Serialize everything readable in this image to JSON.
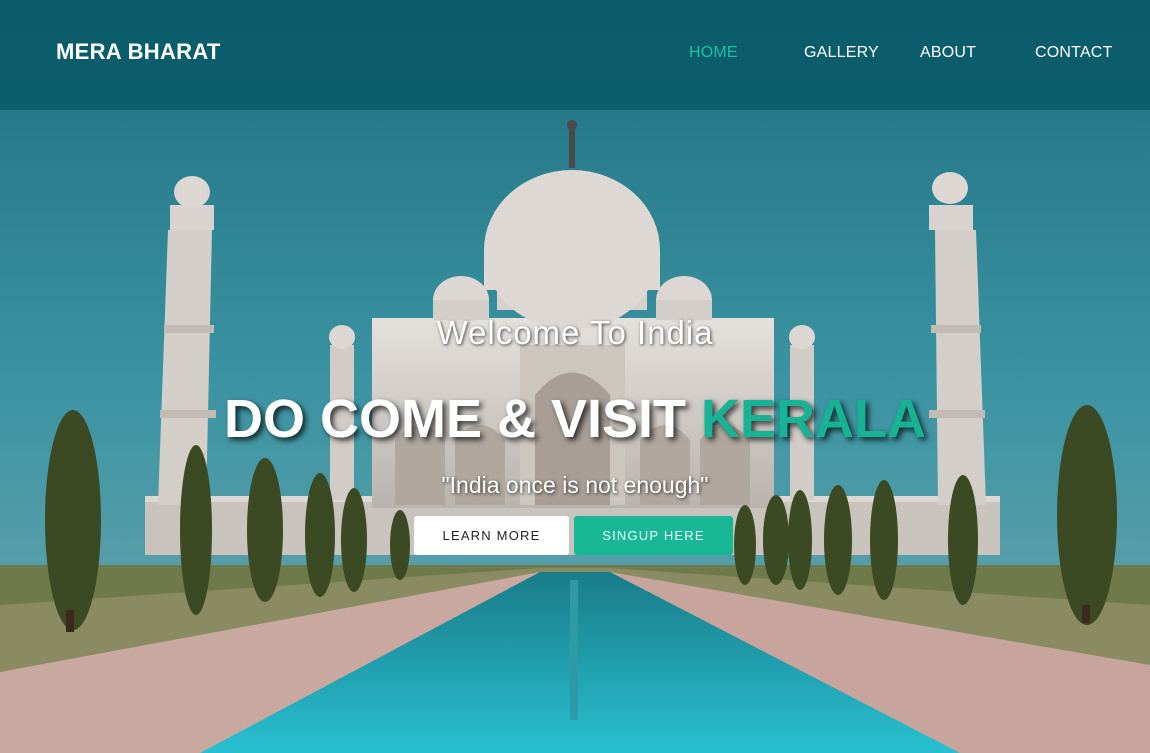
{
  "brand": "MERA BHARAT",
  "nav": {
    "items": [
      {
        "label": "HOME",
        "active": true
      },
      {
        "label": "GALLERY",
        "active": false
      },
      {
        "label": "ABOUT",
        "active": false
      },
      {
        "label": "CONTACT",
        "active": false
      }
    ]
  },
  "hero": {
    "welcome": "Welcome To India",
    "headline_main": "DO COME & VISIT ",
    "headline_accent": "KERALA",
    "tagline": "\"India once is not enough\"",
    "learn_more_label": "LEARN MORE",
    "signup_label": "SINGUP HERE"
  },
  "colors": {
    "accent": "#16b394",
    "nav_bg": "#065866",
    "sky": "#2d8a98"
  }
}
